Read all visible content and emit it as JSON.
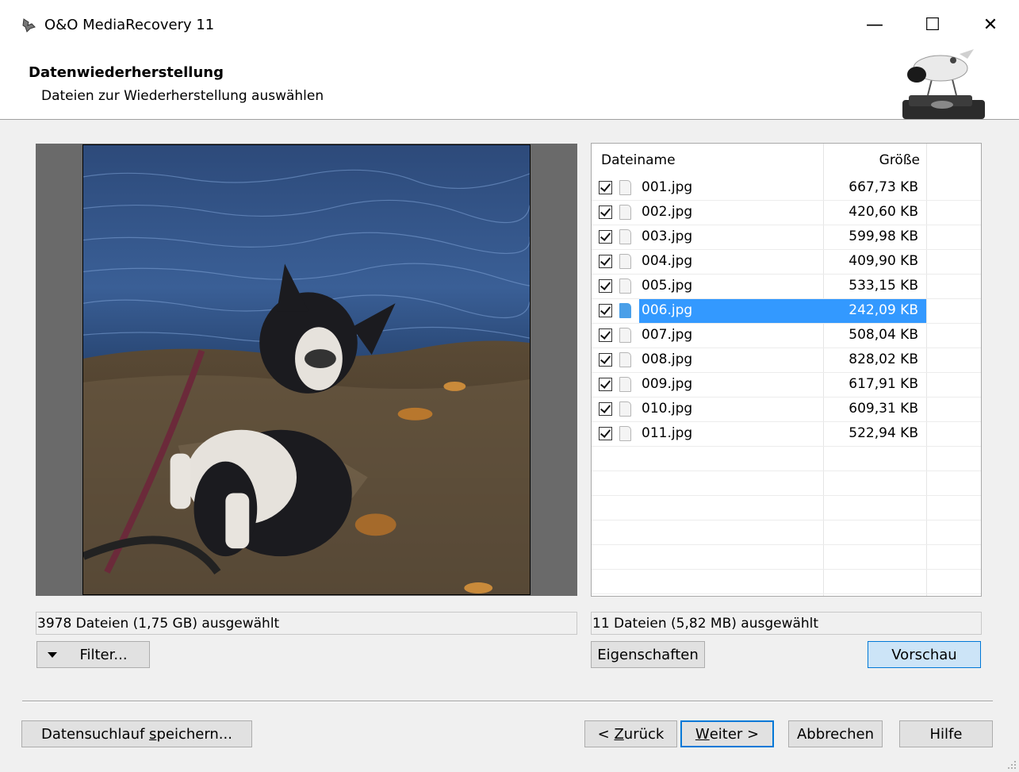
{
  "window": {
    "title": "O&O MediaRecovery 11",
    "minimize": "—",
    "maximize": "☐",
    "close": "✕"
  },
  "header": {
    "title": "Datenwiederherstellung",
    "subtitle": "Dateien zur Wiederherstellung auswählen"
  },
  "filelist": {
    "columns": {
      "name": "Dateiname",
      "size": "Größe"
    },
    "rows": [
      {
        "name": "001.jpg",
        "size": "667,73 KB",
        "checked": true,
        "selected": false
      },
      {
        "name": "002.jpg",
        "size": "420,60 KB",
        "checked": true,
        "selected": false
      },
      {
        "name": "003.jpg",
        "size": "599,98 KB",
        "checked": true,
        "selected": false
      },
      {
        "name": "004.jpg",
        "size": "409,90 KB",
        "checked": true,
        "selected": false
      },
      {
        "name": "005.jpg",
        "size": "533,15 KB",
        "checked": true,
        "selected": false
      },
      {
        "name": "006.jpg",
        "size": "242,09 KB",
        "checked": true,
        "selected": true
      },
      {
        "name": "007.jpg",
        "size": "508,04 KB",
        "checked": true,
        "selected": false
      },
      {
        "name": "008.jpg",
        "size": "828,02 KB",
        "checked": true,
        "selected": false
      },
      {
        "name": "009.jpg",
        "size": "617,91 KB",
        "checked": true,
        "selected": false
      },
      {
        "name": "010.jpg",
        "size": "609,31 KB",
        "checked": true,
        "selected": false
      },
      {
        "name": "011.jpg",
        "size": "522,94 KB",
        "checked": true,
        "selected": false
      }
    ]
  },
  "status": {
    "left": "3978 Dateien (1,75 GB) ausgewählt",
    "right": "11 Dateien (5,82 MB) ausgewählt"
  },
  "buttons": {
    "filter": "Filter...",
    "properties": "Eigenschaften",
    "preview": "Vorschau",
    "save_scan_prefix": "Datensuchlauf ",
    "save_scan_accel": "s",
    "save_scan_suffix": "peichern...",
    "back_prefix": "< ",
    "back_accel": "Z",
    "back_suffix": "urück",
    "next_accel": "W",
    "next_suffix": "eiter >",
    "cancel": "Abbrechen",
    "help": "Hilfe"
  }
}
